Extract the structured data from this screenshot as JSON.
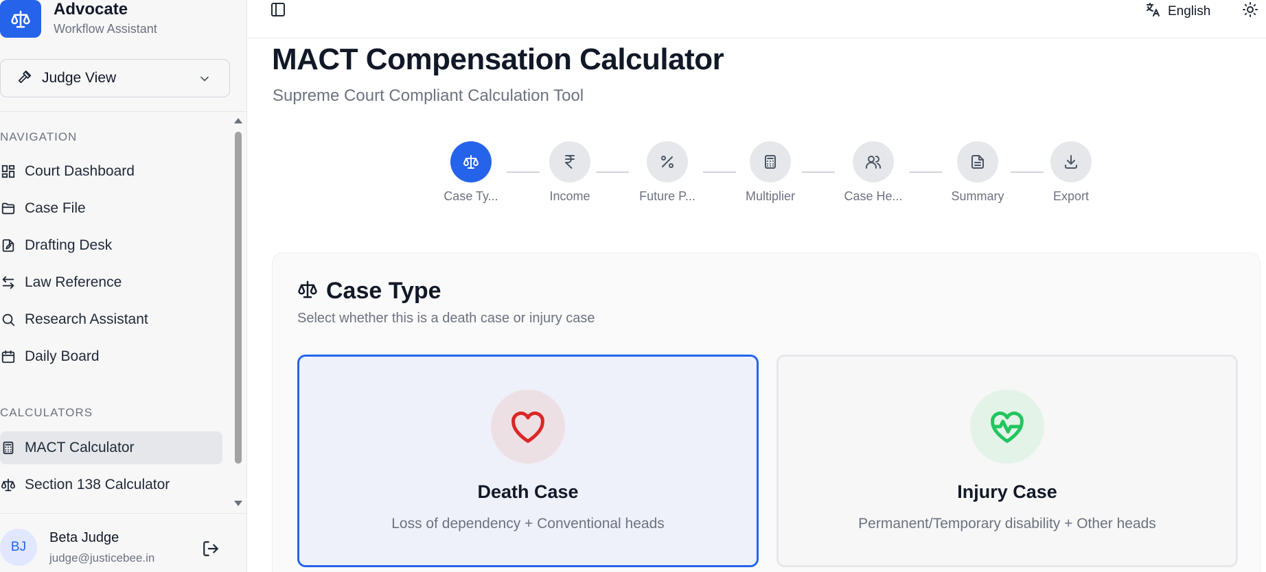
{
  "brand": {
    "title": "Advocate",
    "subtitle": "Workflow Assistant"
  },
  "role_select": {
    "value": "Judge View"
  },
  "navigation": {
    "section_label": "NAVIGATION",
    "items": [
      {
        "label": "Court Dashboard",
        "icon": "dashboard-icon"
      },
      {
        "label": "Case File",
        "icon": "folder-icon"
      },
      {
        "label": "Drafting Desk",
        "icon": "file-edit-icon"
      },
      {
        "label": "Law Reference",
        "icon": "arrows-icon"
      },
      {
        "label": "Research Assistant",
        "icon": "search-icon"
      },
      {
        "label": "Daily Board",
        "icon": "calendar-icon"
      }
    ]
  },
  "calculators": {
    "section_label": "CALCULATORS",
    "items": [
      {
        "label": "MACT Calculator",
        "icon": "calculator-icon",
        "active": true
      },
      {
        "label": "Section 138 Calculator",
        "icon": "scale-icon",
        "active": false
      }
    ]
  },
  "user": {
    "initials": "BJ",
    "name": "Beta Judge",
    "email": "judge@justicebee.in"
  },
  "topbar": {
    "language": "English"
  },
  "page": {
    "title": "MACT Compensation Calculator",
    "subtitle": "Supreme Court Compliant Calculation Tool"
  },
  "steps": [
    {
      "label": "Case Ty...",
      "icon": "scale-icon",
      "active": true
    },
    {
      "label": "Income",
      "icon": "rupee-icon",
      "active": false
    },
    {
      "label": "Future P...",
      "icon": "percent-icon",
      "active": false
    },
    {
      "label": "Multiplier",
      "icon": "calculator-icon",
      "active": false
    },
    {
      "label": "Case He...",
      "icon": "users-icon",
      "active": false
    },
    {
      "label": "Summary",
      "icon": "document-icon",
      "active": false
    },
    {
      "label": "Export",
      "icon": "download-icon",
      "active": false
    }
  ],
  "case_type": {
    "title": "Case Type",
    "description": "Select whether this is a death case or injury case",
    "options": [
      {
        "title": "Death Case",
        "description": "Loss of dependency + Conventional heads",
        "selected": true
      },
      {
        "title": "Injury Case",
        "description": "Permanent/Temporary disability + Other heads",
        "selected": false
      }
    ]
  },
  "colors": {
    "accent": "#2563eb",
    "death": "#dc2626",
    "injury": "#22c55e"
  }
}
